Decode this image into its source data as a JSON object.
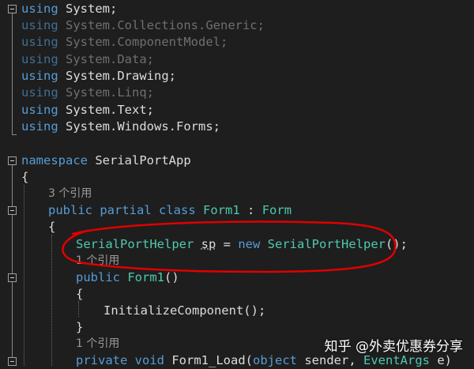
{
  "editor": {
    "background_color": "#1e1e1e",
    "keyword_color": "#569cd6",
    "type_color": "#4ec9b0",
    "text_color": "#dcdcdc",
    "annotation_color": "#e00000",
    "using_keyword": "using",
    "usings": [
      {
        "namespace": "System;",
        "used": true
      },
      {
        "namespace": "System.Collections.Generic;",
        "used": false
      },
      {
        "namespace": "System.ComponentModel;",
        "used": false
      },
      {
        "namespace": "System.Data;",
        "used": false
      },
      {
        "namespace": "System.Drawing;",
        "used": true
      },
      {
        "namespace": "System.Linq;",
        "used": false
      },
      {
        "namespace": "System.Text;",
        "used": true
      },
      {
        "namespace": "System.Windows.Forms;",
        "used": true
      }
    ],
    "namespace_keyword": "namespace",
    "namespace_name": "SerialPortApp",
    "open_brace": "{",
    "close_brace": "}",
    "class_refs": "3 个引用",
    "class_decl": {
      "public": "public",
      "partial": "partial",
      "class": "class",
      "name": "Form1",
      "colon": " : ",
      "base": "Form"
    },
    "field": {
      "type": "SerialPortHelper",
      "name": "sp",
      "equals": " = ",
      "new": "new",
      "ctor": "SerialPortHelper",
      "tail": "();"
    },
    "ctor_refs": "1 个引用",
    "ctor_decl": {
      "public": "public",
      "name": "Form1",
      "parens": "()"
    },
    "init_call": "InitializeComponent();",
    "load_refs": "1 个引用",
    "load_decl": {
      "private": "private",
      "void": "void",
      "name": "Form1_Load(",
      "object": "object",
      "sender": " sender, ",
      "eventargs": "EventArgs",
      "e": " e)"
    }
  },
  "watermark": "知乎 @外卖优惠券分享"
}
